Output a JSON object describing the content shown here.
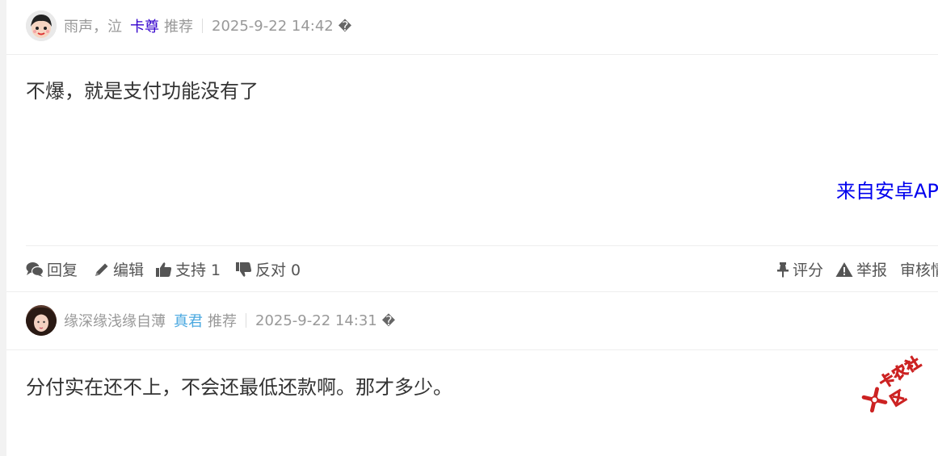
{
  "posts": [
    {
      "username": "雨声，泣",
      "rank": "卡尊",
      "rank_color": "#3300cc",
      "recommend": "推荐",
      "time": "2025-9-22 14:42",
      "more_glyph": "�",
      "content": "不爆，就是支付功能没有了",
      "source": "来自安卓AP",
      "actions": {
        "reply": "回复",
        "edit": "编辑",
        "support": "支持 1",
        "oppose": "反对 0",
        "rate": "评分",
        "report": "举报",
        "review": "审核情"
      }
    },
    {
      "username": "缘深缘浅缘自薄",
      "rank": "真君",
      "rank_color": "#4aa8e0",
      "recommend": "推荐",
      "time": "2025-9-22 14:31",
      "more_glyph": "�",
      "content": "分付实在还不上，不会还最低还款啊。那才多少。"
    }
  ],
  "watermark": "卡农社区",
  "icons": [
    "comments-icon",
    "pencil-icon",
    "thumbs-up-icon",
    "thumbs-down-icon",
    "pin-icon",
    "warning-icon",
    "watermark-logo-icon"
  ]
}
